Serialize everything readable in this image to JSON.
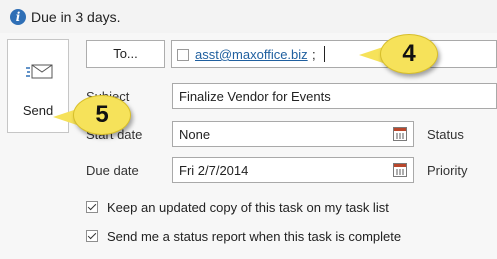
{
  "infobar": {
    "text": "Due in 3 days.",
    "icon": "info-icon"
  },
  "send": {
    "label": "Send",
    "icon": "send-icon"
  },
  "to": {
    "button_label": "To...",
    "recipient": "asst@maxoffice.biz",
    "separator": ";"
  },
  "fields": {
    "subject_label": "Subject",
    "subject_value": "Finalize Vendor for Events",
    "start_date_label": "Start date",
    "start_date_value": "None",
    "due_date_label": "Due date",
    "due_date_value": "Fri 2/7/2014",
    "status_label": "Status",
    "priority_label": "Priority"
  },
  "options": {
    "keep_copy_label": "Keep an updated copy of this task on my task list",
    "keep_copy_checked": true,
    "status_report_label": "Send me a status report when this task is complete",
    "status_report_checked": true
  },
  "callouts": {
    "four": "4",
    "five": "5"
  },
  "colors": {
    "callout_fill": "#f6e25a",
    "info_icon": "#2f6fb6",
    "link": "#1f5f9f"
  }
}
